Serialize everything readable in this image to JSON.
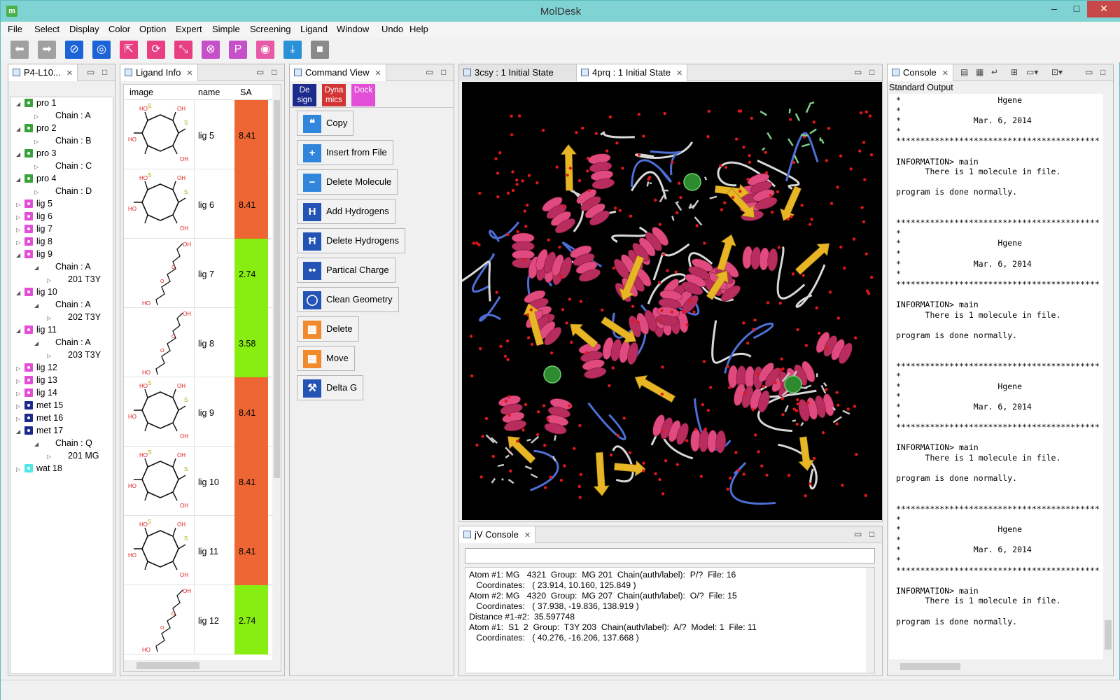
{
  "app": {
    "title": "MolDesk",
    "icon_letter": "m",
    "minimize": "–",
    "maximize": "□",
    "close": "✕"
  },
  "menu": [
    "File",
    "Select",
    "Display",
    "Color",
    "Option",
    "Expert",
    "Simple",
    "Screening",
    "Ligand",
    "Window",
    "Undo",
    "Help"
  ],
  "toolbar": [
    {
      "name": "back-arrow-icon",
      "glyph": "⬅",
      "color": "#a0a0a0"
    },
    {
      "name": "forward-arrow-icon",
      "glyph": "➡",
      "color": "#a0a0a0"
    },
    {
      "name": "cancel-circle-icon",
      "glyph": "⊘",
      "color": "#1d63d8"
    },
    {
      "name": "target-circle-icon",
      "glyph": "◎",
      "color": "#1d63d8"
    },
    {
      "name": "select-arrow-icon",
      "glyph": "⇱",
      "color": "#e83f83"
    },
    {
      "name": "rotate-icon",
      "glyph": "⟳",
      "color": "#e83f83"
    },
    {
      "name": "shrink-icon",
      "glyph": "⤡",
      "color": "#e83f83"
    },
    {
      "name": "hide-icon",
      "glyph": "⊗",
      "color": "#c550c9"
    },
    {
      "name": "p-icon",
      "glyph": "P",
      "color": "#c550c9"
    },
    {
      "name": "eye-icon",
      "glyph": "◉",
      "color": "#e85aa8"
    },
    {
      "name": "download-icon",
      "glyph": "⤓",
      "color": "#2a90d8"
    },
    {
      "name": "stop-square-icon",
      "glyph": "■",
      "color": "#8a8a8a"
    }
  ],
  "tree_panel": {
    "tab": "P4-L10...",
    "rows": [
      {
        "toggle": "◢",
        "depth": 0,
        "icon": "#3aa23a",
        "label": "pro 1"
      },
      {
        "toggle": "▷",
        "depth": 1,
        "icon": "",
        "label": "Chain : A"
      },
      {
        "toggle": "◢",
        "depth": 0,
        "icon": "#3aa23a",
        "label": "pro 2"
      },
      {
        "toggle": "▷",
        "depth": 1,
        "icon": "",
        "label": "Chain : B"
      },
      {
        "toggle": "◢",
        "depth": 0,
        "icon": "#3aa23a",
        "label": "pro 3"
      },
      {
        "toggle": "▷",
        "depth": 1,
        "icon": "",
        "label": "Chain : C"
      },
      {
        "toggle": "◢",
        "depth": 0,
        "icon": "#3aa23a",
        "label": "pro 4"
      },
      {
        "toggle": "▷",
        "depth": 1,
        "icon": "",
        "label": "Chain : D"
      },
      {
        "toggle": "▷",
        "depth": 0,
        "icon": "#e24fd6",
        "label": "lig 5"
      },
      {
        "toggle": "▷",
        "depth": 0,
        "icon": "#e24fd6",
        "label": "lig 6"
      },
      {
        "toggle": "▷",
        "depth": 0,
        "icon": "#e24fd6",
        "label": "lig 7"
      },
      {
        "toggle": "▷",
        "depth": 0,
        "icon": "#e24fd6",
        "label": "lig 8"
      },
      {
        "toggle": "◢",
        "depth": 0,
        "icon": "#e24fd6",
        "label": "lig 9"
      },
      {
        "toggle": "◢",
        "depth": 1,
        "icon": "",
        "label": "Chain : A"
      },
      {
        "toggle": "▷",
        "depth": 2,
        "icon": "",
        "label": "201 T3Y"
      },
      {
        "toggle": "◢",
        "depth": 0,
        "icon": "#e24fd6",
        "label": "lig 10"
      },
      {
        "toggle": "◢",
        "depth": 1,
        "icon": "",
        "label": "Chain : A"
      },
      {
        "toggle": "▷",
        "depth": 2,
        "icon": "",
        "label": "202 T3Y"
      },
      {
        "toggle": "◢",
        "depth": 0,
        "icon": "#e24fd6",
        "label": "lig 11"
      },
      {
        "toggle": "◢",
        "depth": 1,
        "icon": "",
        "label": "Chain : A"
      },
      {
        "toggle": "▷",
        "depth": 2,
        "icon": "",
        "label": "203 T3Y"
      },
      {
        "toggle": "▷",
        "depth": 0,
        "icon": "#e24fd6",
        "label": "lig 12"
      },
      {
        "toggle": "▷",
        "depth": 0,
        "icon": "#e24fd6",
        "label": "lig 13"
      },
      {
        "toggle": "▷",
        "depth": 0,
        "icon": "#e24fd6",
        "label": "lig 14"
      },
      {
        "toggle": "▷",
        "depth": 0,
        "icon": "#1c2a8c",
        "label": "met 15"
      },
      {
        "toggle": "▷",
        "depth": 0,
        "icon": "#1c2a8c",
        "label": "met 16"
      },
      {
        "toggle": "◢",
        "depth": 0,
        "icon": "#1c2a8c",
        "label": "met 17"
      },
      {
        "toggle": "◢",
        "depth": 1,
        "icon": "",
        "label": "Chain : Q"
      },
      {
        "toggle": "▷",
        "depth": 2,
        "icon": "",
        "label": "201  MG"
      },
      {
        "toggle": "▷",
        "depth": 0,
        "icon": "#4fe6e6",
        "label": "wat 18"
      }
    ]
  },
  "ligand_panel": {
    "tab": "Ligand Info",
    "headers": {
      "image": "image",
      "name": "name",
      "sa": "SA"
    },
    "rows": [
      {
        "name": "lig 5",
        "sa": "8.41",
        "color": "#ee6633",
        "shape": "ring"
      },
      {
        "name": "lig 6",
        "sa": "8.41",
        "color": "#ee6633",
        "shape": "ring"
      },
      {
        "name": "lig 7",
        "sa": "2.74",
        "color": "#88ee11",
        "shape": "chain"
      },
      {
        "name": "lig 8",
        "sa": "3.58",
        "color": "#88ee11",
        "shape": "chain"
      },
      {
        "name": "lig 9",
        "sa": "8.41",
        "color": "#ee6633",
        "shape": "ring"
      },
      {
        "name": "lig 10",
        "sa": "8.41",
        "color": "#ee6633",
        "shape": "ring"
      },
      {
        "name": "lig 11",
        "sa": "8.41",
        "color": "#ee6633",
        "shape": "ring"
      },
      {
        "name": "lig 12",
        "sa": "2.74",
        "color": "#88ee11",
        "shape": "chain"
      }
    ]
  },
  "command_panel": {
    "tab": "Command View",
    "modes": [
      {
        "label": "De\nsign",
        "color": "#1c2a8c"
      },
      {
        "label": "Dyna\nmics",
        "color": "#d23333"
      },
      {
        "label": "Dock",
        "color": "#e24fd6"
      }
    ],
    "buttons": [
      {
        "label": "Copy",
        "icon": "quote-icon",
        "glyph": "❝",
        "color": "#2f86db"
      },
      {
        "label": "Insert from File",
        "icon": "plus-icon",
        "glyph": "+",
        "color": "#2f86db"
      },
      {
        "label": "Delete Molecule",
        "icon": "minus-icon",
        "glyph": "−",
        "color": "#2f86db"
      },
      {
        "label": "Add Hydrogens",
        "icon": "hydrogen-add-icon",
        "glyph": "H",
        "color": "#2353b5"
      },
      {
        "label": "Delete Hydrogens",
        "icon": "hydrogen-delete-icon",
        "glyph": "Ħ",
        "color": "#2353b5"
      },
      {
        "label": "Partical Charge",
        "icon": "charge-icon",
        "glyph": "••",
        "color": "#2353b5"
      },
      {
        "label": "Clean Geometry",
        "icon": "clean-circle-icon",
        "glyph": "◯",
        "color": "#2353b5"
      },
      {
        "label": "Delete",
        "icon": "grid-delete-icon",
        "glyph": "▦",
        "color": "#f08a2b"
      },
      {
        "label": "Move",
        "icon": "grid-move-icon",
        "glyph": "▦",
        "color": "#f08a2b"
      },
      {
        "label": "Delta G",
        "icon": "hammer-icon",
        "glyph": "⚒",
        "color": "#2353b5"
      }
    ]
  },
  "viewer": {
    "tabs": [
      "3csy : 1 Initial State",
      "4prq : 1 Initial State"
    ]
  },
  "jv_console": {
    "tab": "jV Console",
    "input_value": "",
    "lines": [
      "Atom #1: MG   4321  Group:  MG 201  Chain(auth/label):  P/?  File: 16",
      "   Coordinates:   ( 23.914, 10.160, 125.849 )",
      "Atom #2: MG   4320  Group:  MG 207  Chain(auth/label):  O/?  File: 15",
      "   Coordinates:   ( 37.938, -19.836, 138.919 )",
      "Distance #1-#2:  35.597748",
      "Atom #1:  S1  2  Group:  T3Y 203  Chain(auth/label):  A/?  Model: 1  File: 11",
      "   Coordinates:   ( 40.276, -16.206, 137.668 )"
    ]
  },
  "console_panel": {
    "tab": "Console",
    "header": "Standard Output",
    "lines": [
      "*                    Hgene",
      "*",
      "*               Mar. 6, 2014",
      "*",
      "******************************************",
      "",
      "INFORMATION> main",
      "      There is 1 molecule in file.",
      "",
      "program is done normally.",
      "",
      "",
      "******************************************",
      "*",
      "*                    Hgene",
      "*",
      "*               Mar. 6, 2014",
      "*",
      "******************************************",
      "",
      "INFORMATION> main",
      "      There is 1 molecule in file.",
      "",
      "program is done normally.",
      "",
      "",
      "******************************************",
      "*",
      "*                    Hgene",
      "*",
      "*               Mar. 6, 2014",
      "*",
      "******************************************",
      "",
      "INFORMATION> main",
      "      There is 1 molecule in file.",
      "",
      "program is done normally.",
      "",
      "",
      "******************************************",
      "*",
      "*                    Hgene",
      "*",
      "*               Mar. 6, 2014",
      "*",
      "******************************************",
      "",
      "INFORMATION> main",
      "      There is 1 molecule in file.",
      "",
      "program is done normally."
    ]
  }
}
